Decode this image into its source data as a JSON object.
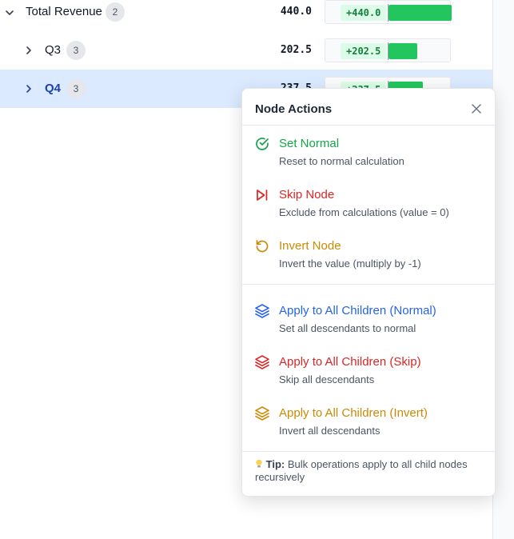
{
  "tree": {
    "rows": [
      {
        "label": "Total Revenue",
        "count": "2",
        "value": "440.0",
        "delta": "+440.0",
        "ratio": 1.0,
        "expanded": true,
        "selected": false
      },
      {
        "label": "Q3",
        "count": "3",
        "value": "202.5",
        "delta": "+202.5",
        "ratio": 0.46,
        "expanded": false,
        "selected": false
      },
      {
        "label": "Q4",
        "count": "3",
        "value": "237.5",
        "delta": "+237.5",
        "ratio": 0.54,
        "expanded": false,
        "selected": true
      }
    ]
  },
  "popup": {
    "title": "Node Actions",
    "close_icon": "close-icon",
    "actions": [
      {
        "label": "Set Normal",
        "desc": "Reset to normal calculation",
        "color": "#16a34a",
        "icon": "check-circle-icon"
      },
      {
        "label": "Skip Node",
        "desc": "Exclude from calculations (value = 0)",
        "color": "#dc2626",
        "icon": "skip-icon"
      },
      {
        "label": "Invert Node",
        "desc": "Invert the value (multiply by -1)",
        "color": "#ca8a04",
        "icon": "rotate-ccw-icon"
      }
    ],
    "bulk_actions": [
      {
        "label": "Apply to All Children (Normal)",
        "desc": "Set all descendants to normal",
        "color": "#2563eb",
        "icon": "layers-icon"
      },
      {
        "label": "Apply to All Children (Skip)",
        "desc": "Skip all descendants",
        "color": "#dc2626",
        "icon": "layers-icon"
      },
      {
        "label": "Apply to All Children (Invert)",
        "desc": "Invert all descendants",
        "color": "#ca8a04",
        "icon": "layers-icon"
      }
    ],
    "tip": {
      "icon": "lightbulb-icon",
      "label": "Tip:",
      "text": "Bulk operations apply to all child nodes recursively"
    }
  },
  "colors": {
    "selected_row": "#dbeafe",
    "bar_fill": "#22c55e",
    "positive_tag": "#dcfce7"
  }
}
